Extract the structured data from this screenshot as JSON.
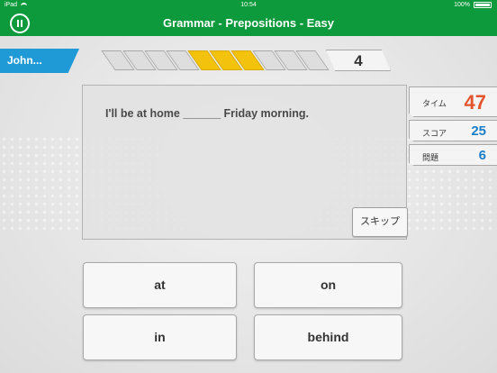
{
  "status_bar": {
    "device": "iPad",
    "time": "10:54",
    "battery": "100%"
  },
  "header": {
    "title": "Grammar - Prepositions - Easy"
  },
  "player": {
    "name": "John..."
  },
  "progress": {
    "completed": 3,
    "total": 10,
    "count": "4"
  },
  "question": {
    "text": "I'll be at home ______ Friday morning.",
    "skip_label": "スキップ"
  },
  "stats": {
    "time_label": "タイム",
    "time_value": "47",
    "score_label": "スコア",
    "score_value": "25",
    "question_label": "問題",
    "question_value": "6"
  },
  "answers": [
    "at",
    "on",
    "in",
    "behind"
  ],
  "colors": {
    "header_green": "#0c9a3c",
    "player_blue": "#1f9ad6",
    "progress_yellow": "#f3c20d",
    "time_red": "#e2552e",
    "stat_blue": "#1b7fc8"
  }
}
